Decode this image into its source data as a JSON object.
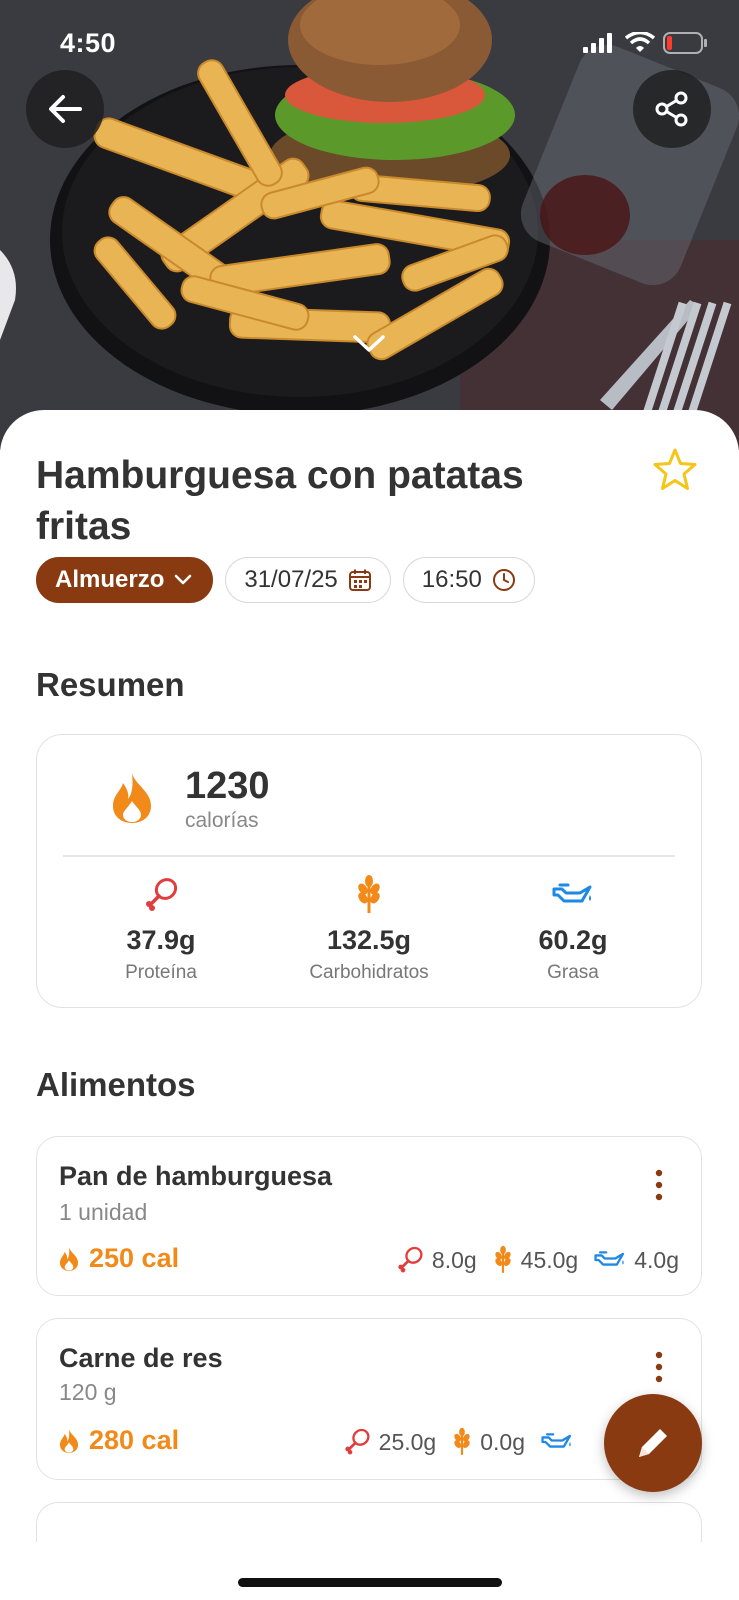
{
  "status_bar": {
    "time": "4:50"
  },
  "meal": {
    "title": "Hamburguesa con patatas fritas",
    "meal_type": "Almuerzo",
    "date": "31/07/25",
    "time": "16:50"
  },
  "summary": {
    "section_title": "Resumen",
    "calories_value": "1230",
    "calories_label": "calorías",
    "macros": [
      {
        "value": "37.9g",
        "label": "Proteína",
        "icon": "drumstick-icon",
        "color": "#e23d3d"
      },
      {
        "value": "132.5g",
        "label": "Carbohidratos",
        "icon": "wheat-icon",
        "color": "#f28a1a"
      },
      {
        "value": "60.2g",
        "label": "Grasa",
        "icon": "oil-can-icon",
        "color": "#1e88e5"
      }
    ]
  },
  "foods": {
    "section_title": "Alimentos",
    "items": [
      {
        "name": "Pan de hamburguesa",
        "quantity": "1 unidad",
        "calories": "250 cal",
        "protein": "8.0g",
        "carbs": "45.0g",
        "fat": "4.0g"
      },
      {
        "name": "Carne de res",
        "quantity": "120 g",
        "calories": "280 cal",
        "protein": "25.0g",
        "carbs": "0.0g",
        "fat": ""
      }
    ]
  },
  "colors": {
    "brand": "#8a3a10",
    "calories": "#f28a1a",
    "protein": "#e23d3d",
    "carbs": "#f28a1a",
    "fat": "#1e88e5",
    "star": "#f5c518"
  }
}
